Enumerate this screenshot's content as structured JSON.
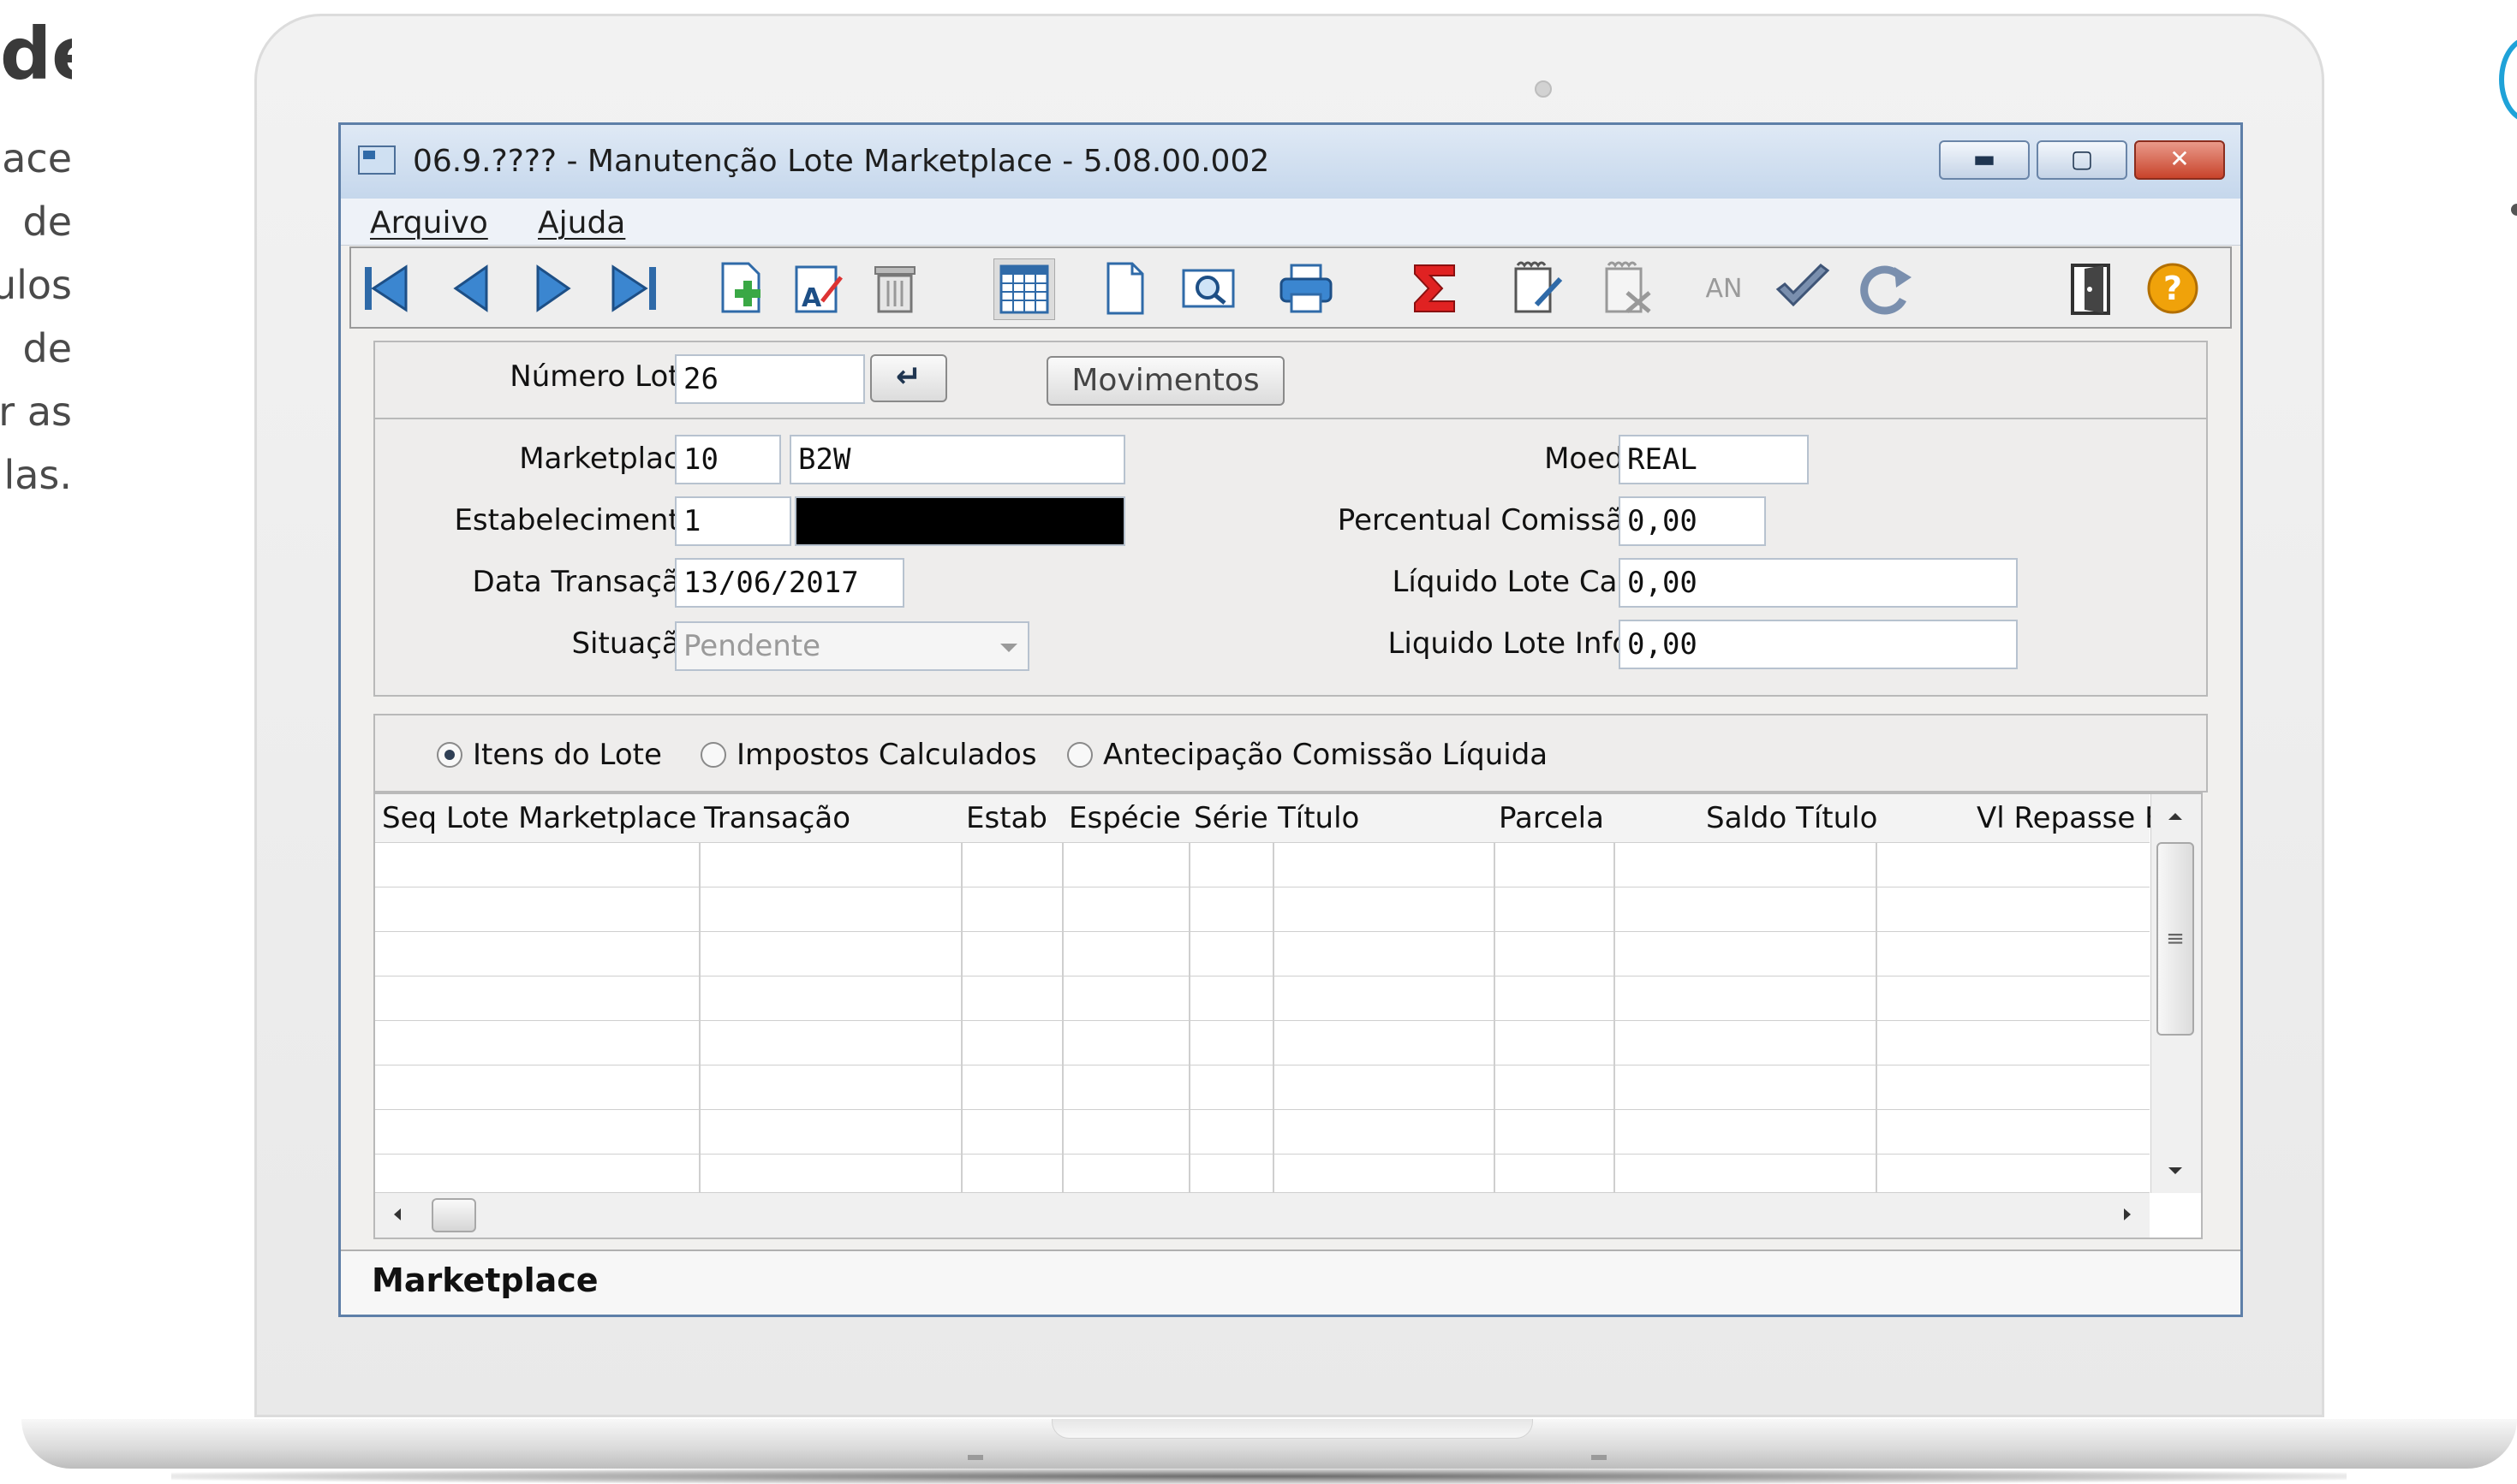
{
  "slide": {
    "title_fragment": "de",
    "text_lines": [
      "ace",
      "de",
      "ulos",
      "de",
      "r as",
      "las."
    ]
  },
  "window": {
    "title": "06.9.???? - Manutenção Lote Marketplace - 5.08.00.002",
    "minimize_label": "▬",
    "maximize_label": "▢",
    "close_label": "✕"
  },
  "menu": {
    "items": [
      {
        "label": "Arquivo"
      },
      {
        "label": "Ajuda"
      }
    ]
  },
  "toolbar": {
    "icons": [
      "first-record-icon",
      "previous-record-icon",
      "next-record-icon",
      "last-record-icon",
      "add-icon",
      "edit-icon",
      "delete-icon",
      "calendar-icon",
      "new-document-icon",
      "preview-icon",
      "print-icon",
      "sum-icon",
      "notes-icon",
      "notes-disabled-icon",
      "an-icon",
      "confirm-check-icon",
      "refresh-icon",
      "exit-door-icon",
      "help-icon"
    ],
    "an_label": "AN",
    "help_label": "?"
  },
  "header_form": {
    "numero_lote_label": "Número Lote:",
    "numero_lote_value": "26",
    "enter_label": "↵",
    "movimentos_label": "Movimentos"
  },
  "details_form": {
    "marketplace_label": "Marketplace:",
    "marketplace_code": "10",
    "marketplace_name": "B2W",
    "estabelecimento_label": "Estabelecimento:",
    "estabelecimento_code": "1",
    "data_transacao_label": "Data Transação:",
    "data_transacao_value": "13/06/2017",
    "situacao_label": "Situação:",
    "situacao_value": "Pendente",
    "moeda_label": "Moeda:",
    "moeda_value": "REAL",
    "percentual_comissao_label": "Percentual Comissão:",
    "percentual_comissao_value": "0,00",
    "liquido_calc_label": "Líquido Lote Calc:",
    "liquido_calc_value": "0,00",
    "liquido_infor_label": "Liquido Lote Infor:",
    "liquido_infor_value": "0,00"
  },
  "tabs": {
    "options": [
      {
        "label": "Itens do Lote",
        "selected": true
      },
      {
        "label": "Impostos Calculados",
        "selected": false
      },
      {
        "label": "Antecipação Comissão Líquida",
        "selected": false
      }
    ]
  },
  "grid": {
    "columns": [
      "Seq Lote Marketplace",
      "Transação",
      "Estab",
      "Espécie",
      "Série",
      "Título",
      "Parcela",
      "Saldo Título",
      "Vl Repasse B"
    ],
    "rows": []
  },
  "status": {
    "text": "Marketplace"
  },
  "colors": {
    "accent_blue": "#2f6aa8",
    "close_red": "#c8432b",
    "help_orange": "#f0a20a",
    "sum_red": "#e02222"
  }
}
